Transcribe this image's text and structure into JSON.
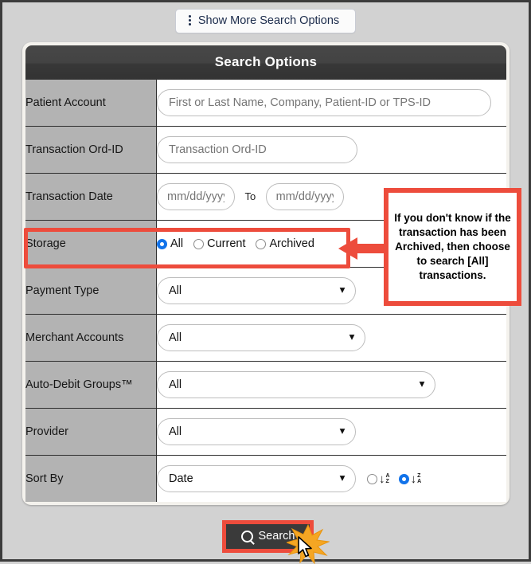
{
  "topbar": {
    "show_more_label": "Show More Search Options",
    "kebab_icon": "vertical-dots-icon"
  },
  "panel": {
    "title": "Search Options",
    "rows": [
      {
        "label": "Patient Account",
        "type": "text",
        "value": "",
        "placeholder": "First or Last Name, Company, Patient-ID or TPS-ID"
      },
      {
        "label": "Transaction Ord-ID",
        "type": "text",
        "value": "",
        "placeholder": "Transaction Ord-ID"
      },
      {
        "label": "Transaction Date",
        "type": "daterange",
        "from_placeholder": "mm/dd/yyyy",
        "to_label": "To",
        "to_placeholder": "mm/dd/yyyy"
      },
      {
        "label": "Storage",
        "type": "radio",
        "options": [
          "All",
          "Current",
          "Archived"
        ],
        "selected": "All"
      },
      {
        "label": "Payment Type",
        "type": "select",
        "value": "All"
      },
      {
        "label": "Merchant Accounts",
        "type": "select",
        "value": "All"
      },
      {
        "label": "Auto-Debit Groups™",
        "type": "select",
        "value": "All"
      },
      {
        "label": "Provider",
        "type": "select",
        "value": "All"
      },
      {
        "label": "Sort By",
        "type": "select_sort",
        "value": "Date",
        "sort_options": [
          {
            "icon": "sort-ascending-az-icon",
            "top": "A",
            "bottom": "Z",
            "selected": false
          },
          {
            "icon": "sort-descending-za-icon",
            "top": "Z",
            "bottom": "A",
            "selected": true
          }
        ]
      }
    ]
  },
  "annotation": {
    "callout_text": "If you don't know if the transaction has been Archived, then choose to search [All] transactions.",
    "arrow_icon": "left-arrow-icon",
    "highlight_color": "#ed4c3c"
  },
  "footer": {
    "search_label": "Search",
    "search_icon": "magnifier-icon",
    "click_burst_icon": "click-burst-icon",
    "cursor_icon": "mouse-cursor-icon"
  }
}
